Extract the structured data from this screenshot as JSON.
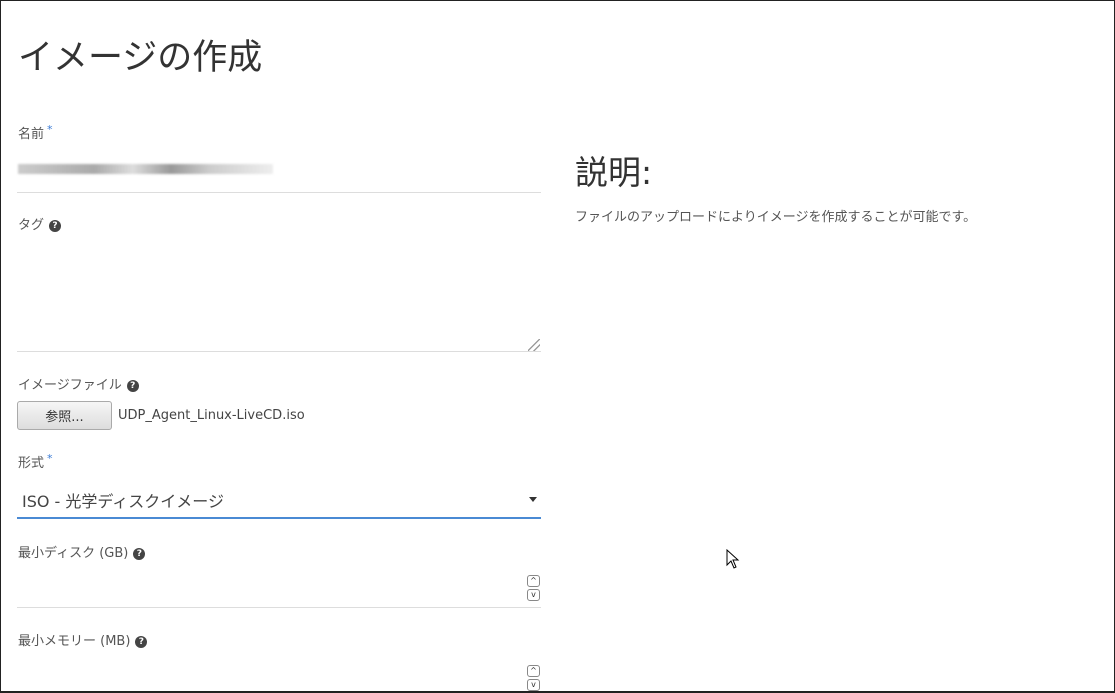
{
  "title": "イメージの作成",
  "fields": {
    "name": {
      "label": "名前",
      "required": "*"
    },
    "tags": {
      "label": "タグ",
      "help": "?"
    },
    "image_file": {
      "label": "イメージファイル",
      "help": "?",
      "browse": "参照...",
      "file": "UDP_Agent_Linux-LiveCD.iso"
    },
    "format": {
      "label": "形式",
      "required": "*",
      "value": "ISO - 光学ディスクイメージ"
    },
    "min_disk": {
      "label": "最小ディスク (GB)",
      "help": "?"
    },
    "min_memory": {
      "label": "最小メモリー (MB)",
      "help": "?"
    }
  },
  "description": {
    "heading": "説明:",
    "text": "ファイルのアップロードによりイメージを作成することが可能です。"
  },
  "colors": {
    "accent": "#4a8ad4"
  }
}
